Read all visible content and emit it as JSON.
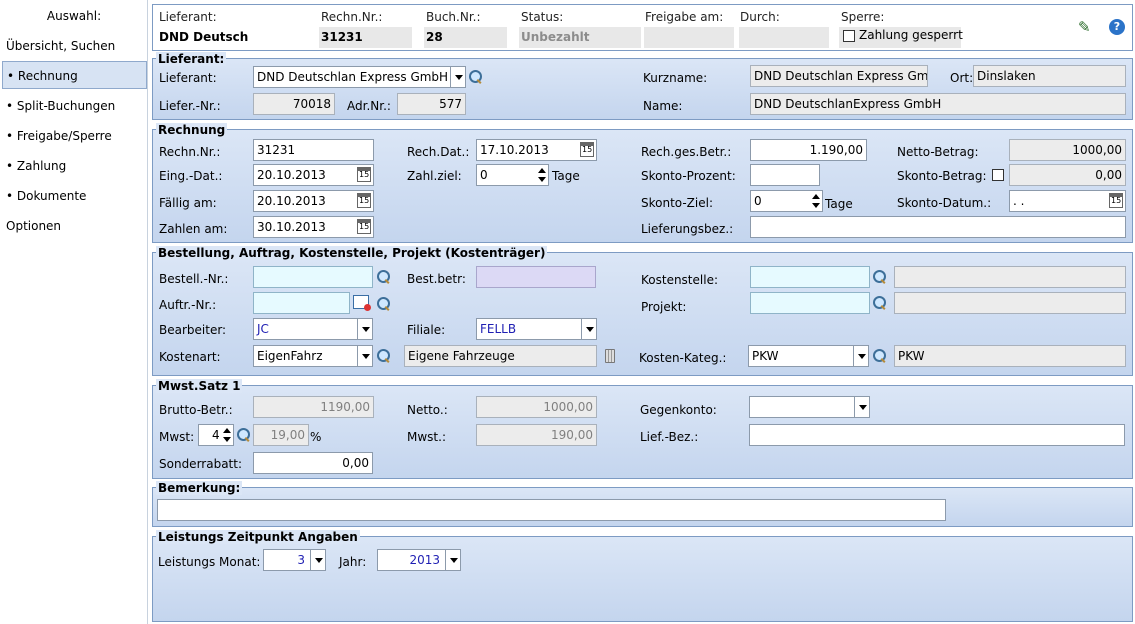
{
  "sidebar": {
    "title": "Auswahl:",
    "items": [
      {
        "label": "Übersicht, Suchen"
      },
      {
        "label": "• Rechnung"
      },
      {
        "label": "• Split-Buchungen"
      },
      {
        "label": "• Freigabe/Sperre"
      },
      {
        "label": "• Zahlung"
      },
      {
        "label": "• Dokumente"
      },
      {
        "label": "Optionen"
      }
    ]
  },
  "header": {
    "lieferant_label": "Lieferant:",
    "lieferant_value": "DND Deutschlan",
    "rechn_label": "Rechn.Nr.:",
    "rechn_value": "31231",
    "buch_label": "Buch.Nr.:",
    "buch_value": "28",
    "status_label": "Status:",
    "status_value": "Unbezahlt",
    "freigabe_label": "Freigabe am:",
    "freigabe_value": "",
    "durch_label": "Durch:",
    "durch_value": "",
    "sperre_label": "Sperre:",
    "zahlung_gesperrt": "Zahlung gesperrt",
    "help_icon_glyph": "?",
    "edit_icon_glyph": "✎"
  },
  "lieferant": {
    "legend": "Lieferant:",
    "lieferant_label": "Lieferant:",
    "lieferant_value": "DND Deutschlan Express GmbH",
    "kurzname_label": "Kurzname:",
    "kurzname_value": "DND Deutschlan Express GmbH",
    "ort_label": "Ort:",
    "ort_value": "Dinslaken",
    "liefernr_label": "Liefer.-Nr.:",
    "liefernr_value": "70018",
    "adrnr_label": "Adr.Nr.:",
    "adrnr_value": "577",
    "name_label": "Name:",
    "name_value": "DND DeutschlanExpress GmbH"
  },
  "rechnung": {
    "legend": "Rechnung",
    "rechnnr_label": "Rechn.Nr.:",
    "rechnnr_value": "31231",
    "rechdat_label": "Rech.Dat.:",
    "rechdat_value": "17.10.2013",
    "gesbetr_label": "Rech.ges.Betr.:",
    "gesbetr_value": "1.190,00",
    "netto_label": "Netto-Betrag:",
    "netto_value": "1000,00",
    "eingdat_label": "Eing.-Dat.:",
    "eingdat_value": "20.10.2013",
    "zahlziel_label": "Zahl.ziel:",
    "zahlziel_value": "0",
    "tage_label": "Tage",
    "skontoproz_label": "Skonto-Prozent:",
    "skontoproz_value": "",
    "skontobetr_label": "Skonto-Betrag:",
    "skontobetr_value": "0,00",
    "faellig_label": "Fällig am:",
    "faellig_value": "20.10.2013",
    "skontoziel_label": "Skonto-Ziel:",
    "skontoziel_value": "0",
    "tage2_label": "Tage",
    "skontodatum_label": "Skonto-Datum.:",
    "skontodatum_value": " .  .",
    "zahlen_label": "Zahlen am:",
    "zahlen_value": "30.10.2013",
    "lieferbez_label": "Lieferungsbez.:",
    "lieferbez_value": ""
  },
  "bestellung": {
    "legend": "Bestellung, Auftrag, Kostenstelle, Projekt (Kostenträger)",
    "bestellnr_label": "Bestell.-Nr.:",
    "bestellnr_value": "",
    "bestbetr_label": "Best.betr:",
    "bestbetr_value": "",
    "kostenstelle_label": "Kostenstelle:",
    "kostenstelle_value": "",
    "kostenstelle_desc": "",
    "auftrnr_label": "Auftr.-Nr.:",
    "auftrnr_value": "",
    "projekt_label": "Projekt:",
    "projekt_value": "",
    "projekt_desc": "",
    "bearbeiter_label": "Bearbeiter:",
    "bearbeiter_value": "JC",
    "filiale_label": "Filiale:",
    "filiale_value": "FELLB",
    "kostenart_label": "Kostenart:",
    "kostenart_value": "EigenFahrz",
    "kostenart_desc": "Eigene Fahrzeuge",
    "kostenkateg_label": "Kosten-Kateg.:",
    "kostenkateg_value": "PKW",
    "kostenkateg_desc": "PKW"
  },
  "mwst": {
    "legend": "Mwst.Satz 1",
    "brutto_label": "Brutto-Betr.:",
    "brutto_value": "1190,00",
    "netto_label": "Netto.:",
    "netto_value": "1000,00",
    "gegenkonto_label": "Gegenkonto:",
    "gegenkonto_value": "",
    "mwst_label": "Mwst:",
    "mwst_code": "4",
    "mwst_rate": "19,00",
    "percent": "%",
    "mwst2_label": "Mwst.:",
    "mwst2_value": "190,00",
    "liefbez_label": "Lief.-Bez.:",
    "liefbez_value": "",
    "sonderrabatt_label": "Sonderrabatt:",
    "sonderrabatt_value": "0,00"
  },
  "bemerkung": {
    "legend": "Bemerkung:",
    "value": ""
  },
  "leistung": {
    "legend": "Leistungs Zeitpunkt Angaben",
    "monat_label": "Leistungs Monat:",
    "monat_value": "3",
    "jahr_label": "Jahr:",
    "jahr_value": "2013"
  }
}
